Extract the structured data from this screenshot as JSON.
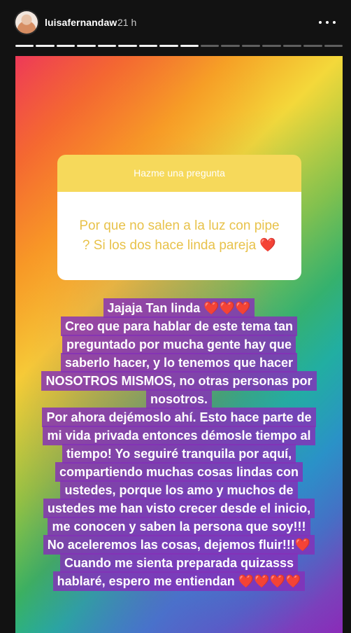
{
  "header": {
    "username": "luisafernandaw",
    "time": "21 h",
    "progress": {
      "total": 16,
      "done": 9
    }
  },
  "question_card": {
    "title": "Hazme una pregunta",
    "question": "Por que no salen a la luz con pipe ? Si los dos hace linda pareja ❤️"
  },
  "answer": {
    "lines": [
      "Jajaja Tan linda ❤️❤️❤️",
      "Creo que para hablar de este tema tan",
      "preguntado por mucha gente hay que",
      "saberlo hacer, y lo tenemos que hacer",
      "NOSOTROS MISMOS, no otras personas por",
      "nosotros.",
      "Por ahora dejémoslo ahí. Esto hace parte de",
      "mi vida privada entonces démosle tiempo al",
      "tiempo! Yo seguiré tranquila por aquí,",
      "compartiendo muchas cosas lindas con",
      "ustedes, porque los amo y muchos de",
      "ustedes me han visto crecer desde el inicio,",
      "me conocen y saben la persona que soy!!!",
      "No aceleremos las cosas, dejemos fluir!!!❤️",
      "Cuando me sienta preparada quizasss",
      "hablaré, espero me entiendan ❤️❤️❤️❤️"
    ]
  },
  "colors": {
    "header_bg": "#121212",
    "question_header": "#f6d95b",
    "question_text": "#e8c24a",
    "answer_highlight": "#852fb8"
  }
}
